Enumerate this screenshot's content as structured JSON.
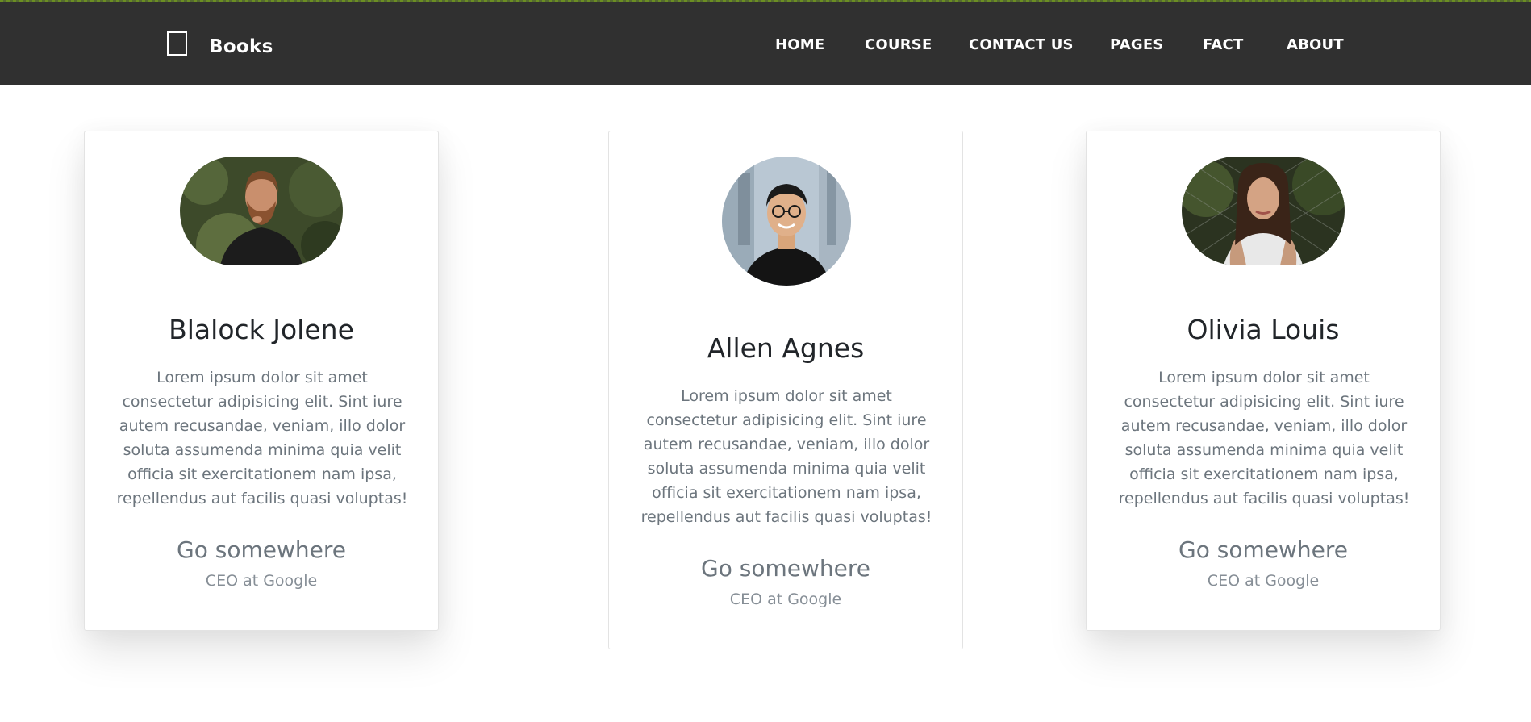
{
  "brand": {
    "name": "Books",
    "icon": "book-icon"
  },
  "nav": {
    "items": [
      {
        "label": "HOME"
      },
      {
        "label": "COURSE"
      },
      {
        "label": "CONTACT US"
      },
      {
        "label": "PAGES"
      },
      {
        "label": "FACT"
      },
      {
        "label": "ABOUT"
      }
    ]
  },
  "cards": [
    {
      "name": "Blalock Jolene",
      "description": "Lorem ipsum dolor sit amet consectetur adipisicing elit. Sint iure autem recusandae, veniam, illo dolor soluta assumenda minima quia velit officia sit exercitationem nam ipsa, repellendus aut facilis quasi voluptas!",
      "link": "Go somewhere",
      "role": "CEO at Google"
    },
    {
      "name": "Allen Agnes",
      "description": "Lorem ipsum dolor sit amet consectetur adipisicing elit. Sint iure autem recusandae, veniam, illo dolor soluta assumenda minima quia velit officia sit exercitationem nam ipsa, repellendus aut facilis quasi voluptas!",
      "link": "Go somewhere",
      "role": "CEO at Google"
    },
    {
      "name": "Olivia Louis",
      "description": "Lorem ipsum dolor sit amet consectetur adipisicing elit. Sint iure autem recusandae, veniam, illo dolor soluta assumenda minima quia velit officia sit exercitationem nam ipsa, repellendus aut facilis quasi voluptas!",
      "link": "Go somewhere",
      "role": "CEO at Google"
    }
  ],
  "colors": {
    "navbar": "#303030",
    "accent_line": "#6b8e23",
    "text_muted": "#6c757d"
  }
}
